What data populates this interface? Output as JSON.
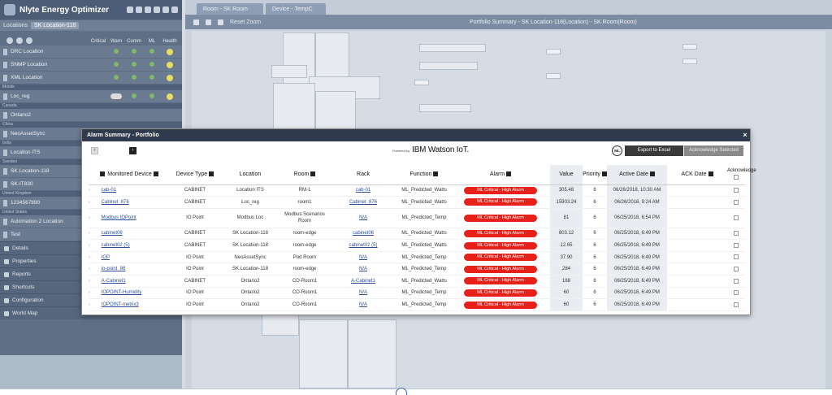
{
  "app": {
    "title": "Nlyte Energy Optimizer",
    "locations_label": "Locations",
    "location_selected": "SK Location-118",
    "status_cols": [
      "Critical",
      "Warn",
      "Comm",
      "ML",
      "Health"
    ]
  },
  "sidebar": {
    "groups": [
      {
        "section": "",
        "items": [
          {
            "label": "DRC Location"
          },
          {
            "label": "SNMP Location"
          },
          {
            "label": "XML Location"
          }
        ]
      },
      {
        "section": "Mobile",
        "items": [
          {
            "label": "Loc_reg"
          }
        ]
      },
      {
        "section": "Canada",
        "items": [
          {
            "label": "Ontario2"
          }
        ]
      },
      {
        "section": "China",
        "items": [
          {
            "label": "NeoAssetSync"
          }
        ]
      },
      {
        "section": "India",
        "items": [
          {
            "label": "Location ITS"
          }
        ]
      },
      {
        "section": "Sweden",
        "items": [
          {
            "label": "SK Location-118"
          },
          {
            "label": "SK-IT830"
          }
        ]
      },
      {
        "section": "United Kingdom",
        "items": [
          {
            "label": "1234567890"
          }
        ]
      },
      {
        "section": "United States",
        "items": [
          {
            "label": "Automation 2 Location"
          },
          {
            "label": "Test"
          }
        ]
      }
    ],
    "panels": [
      "Details",
      "Properties",
      "Reports",
      "Shortcuts",
      "Configuration",
      "World Map"
    ]
  },
  "workspace": {
    "tabs": [
      "Room - SK Room",
      "Device - TempC"
    ],
    "toolbar_label": "Reset Zoom",
    "portfolio_title": "Portfolio Summary - SK Location-118(Location) - SK Room(Room)"
  },
  "modal": {
    "title": "Alarm Summary - Portfolio",
    "close": "×",
    "brand_prefix": "Powered by",
    "brand_name": "IBM Watson IoT.",
    "ml_badge": "ML",
    "export_button": "Export to Excel",
    "ack_button": "Acknowledge Selected",
    "columns": [
      "Monitored Device",
      "Device Type",
      "Location",
      "Room",
      "Rack",
      "Function",
      "Alarm",
      "Value",
      "Priority",
      "Active Date",
      "ACK Date",
      "Acknowledge"
    ],
    "rows": [
      {
        "device": "cab-01",
        "type": "CABINET",
        "location": "Location ITS",
        "room": "RM-1",
        "rack": "cab-01",
        "function": "ML_Predicted_Watts",
        "alarm": "ML Critical - High Alarm",
        "value": "305.48",
        "priority": "6",
        "active_date": "06/26/2018, 10:30 AM",
        "ack_date": ""
      },
      {
        "device": "Cabinet_876",
        "type": "CABINET",
        "location": "Loc_reg",
        "room": "room1",
        "rack": "Cabinet_876",
        "function": "ML_Predicted_Watts",
        "alarm": "ML Critical - High Alarm",
        "value": "15903.24",
        "priority": "6",
        "active_date": "06/26/2018, 9:24 AM",
        "ack_date": ""
      },
      {
        "device": "Modbus IOPoint",
        "type": "IO Point",
        "location": "Modbus Loc",
        "room": "Modbus Scenarios Room",
        "rack": "N/A",
        "function": "ML_Predicted_Temp",
        "alarm": "ML Critical - High Alarm",
        "value": "81",
        "priority": "6",
        "active_date": "06/25/2018, 6:54 PM",
        "ack_date": ""
      },
      {
        "device": "cabinet06",
        "type": "CABINET",
        "location": "SK Location-118",
        "room": "room-edge",
        "rack": "cabinet06",
        "function": "ML_Predicted_Watts",
        "alarm": "ML Critical - High Alarm",
        "value": "803.12",
        "priority": "6",
        "active_date": "06/25/2018, 6:49 PM",
        "ack_date": ""
      },
      {
        "device": "cabinet02 (5)",
        "type": "CABINET",
        "location": "SK Location-118",
        "room": "room-edge",
        "rack": "cabinet02 (5)",
        "function": "ML_Predicted_Watts",
        "alarm": "ML Critical - High Alarm",
        "value": "12.65",
        "priority": "6",
        "active_date": "06/25/2018, 6:49 PM",
        "ack_date": ""
      },
      {
        "device": "IOP",
        "type": "IO Point",
        "location": "NeoAssetSync",
        "room": "Pod Room",
        "rack": "N/A",
        "function": "ML_Predicted_Temp",
        "alarm": "ML Critical - High Alarm",
        "value": "37.90",
        "priority": "6",
        "active_date": "06/25/2018, 6:49 PM",
        "ack_date": ""
      },
      {
        "device": "io-point_86",
        "type": "IO Point",
        "location": "SK Location-118",
        "room": "room-edge",
        "rack": "N/A",
        "function": "ML_Predicted_Temp",
        "alarm": "ML Critical - High Alarm",
        "value": "284",
        "priority": "6",
        "active_date": "06/25/2018, 6:49 PM",
        "ack_date": ""
      },
      {
        "device": "A-Cabinet1",
        "type": "CABINET",
        "location": "Ontario2",
        "room": "CO-Room1",
        "rack": "A-Cabinet1",
        "function": "ML_Predicted_Watts",
        "alarm": "ML Critical - High Alarm",
        "value": "168",
        "priority": "6",
        "active_date": "06/25/2018, 6:49 PM",
        "ack_date": ""
      },
      {
        "device": "IOPOINT-Humidity",
        "type": "IO Point",
        "location": "Ontario2",
        "room": "CO-Room1",
        "rack": "N/A",
        "function": "ML_Predicted_Temp",
        "alarm": "ML Critical - High Alarm",
        "value": "60",
        "priority": "6",
        "active_date": "06/25/2018, 6:49 PM",
        "ack_date": ""
      },
      {
        "device": "IOPOINT-metrix3",
        "type": "IO Point",
        "location": "Ontario2",
        "room": "CO-Room1",
        "rack": "N/A",
        "function": "ML_Predicted_Temp",
        "alarm": "ML Critical - High Alarm",
        "value": "60",
        "priority": "6",
        "active_date": "06/25/2018, 6:49 PM",
        "ack_date": ""
      }
    ]
  },
  "colors": {
    "alarm_red": "#e8201a",
    "link_blue": "#2a4f9a",
    "modal_header": "#2f3b4c",
    "sidebar_bg": "#5f6f86"
  }
}
